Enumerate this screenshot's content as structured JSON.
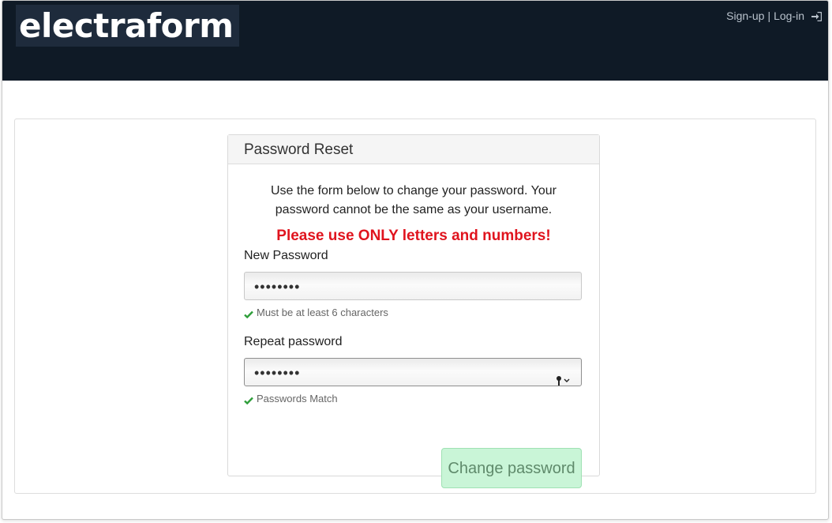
{
  "navbar": {
    "brand": "electraform",
    "signup_label": "Sign-up",
    "separator": "|",
    "login_label": "Log-in",
    "login_icon": "sign-in-icon"
  },
  "panel": {
    "heading": "Password Reset",
    "intro": "Use the form below to change your password. Your password cannot be the same as your username.",
    "warning": "Please use ONLY letters and numbers!"
  },
  "new_password": {
    "label": "New Password",
    "value": "••••••••",
    "help": "Must be at least 6 characters"
  },
  "repeat_password": {
    "label": "Repeat password",
    "value": "••••••••",
    "help": "Passwords Match",
    "autofill_icon": "key-icon"
  },
  "submit": {
    "label": "Change password"
  },
  "colors": {
    "navbar_bg": "#0f1a26",
    "warning": "#e0141e",
    "success": "#2e9e3a",
    "button_bg": "#c9f5d7"
  }
}
